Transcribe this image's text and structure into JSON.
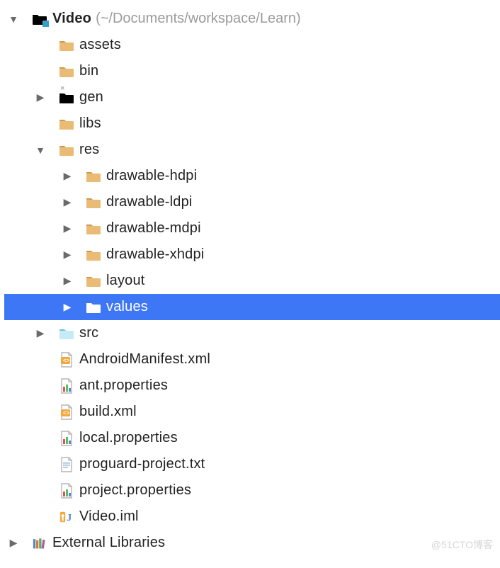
{
  "watermark": "@51CTO博客",
  "tree": [
    {
      "indent": 0,
      "arrow": "down",
      "icon": "folder-tan-badge",
      "bold": true,
      "label": "Video",
      "path": "(~/Documents/workspace/Learn)",
      "interact": true
    },
    {
      "indent": 1,
      "arrow": "",
      "icon": "folder-tan",
      "label": "assets",
      "interact": true
    },
    {
      "indent": 1,
      "arrow": "",
      "icon": "folder-tan",
      "label": "bin",
      "interact": true
    },
    {
      "indent": 1,
      "arrow": "right",
      "icon": "folder-cyan-x",
      "label": "gen",
      "interact": true
    },
    {
      "indent": 1,
      "arrow": "",
      "icon": "folder-tan",
      "label": "libs",
      "interact": true
    },
    {
      "indent": 1,
      "arrow": "down",
      "icon": "folder-tan",
      "label": "res",
      "interact": true
    },
    {
      "indent": 2,
      "arrow": "right",
      "icon": "folder-tan",
      "label": "drawable-hdpi",
      "interact": true
    },
    {
      "indent": 2,
      "arrow": "right",
      "icon": "folder-tan",
      "label": "drawable-ldpi",
      "interact": true
    },
    {
      "indent": 2,
      "arrow": "right",
      "icon": "folder-tan",
      "label": "drawable-mdpi",
      "interact": true
    },
    {
      "indent": 2,
      "arrow": "right",
      "icon": "folder-tan",
      "label": "drawable-xhdpi",
      "interact": true
    },
    {
      "indent": 2,
      "arrow": "right",
      "icon": "folder-tan",
      "label": "layout",
      "interact": true
    },
    {
      "indent": 2,
      "arrow": "right",
      "icon": "folder-white",
      "label": "values",
      "selected": true,
      "interact": true
    },
    {
      "indent": 1,
      "arrow": "right",
      "icon": "folder-cyan",
      "label": "src",
      "interact": true
    },
    {
      "indent": 1,
      "arrow": "",
      "icon": "file-xml",
      "label": "AndroidManifest.xml",
      "interact": true
    },
    {
      "indent": 1,
      "arrow": "",
      "icon": "file-props",
      "label": "ant.properties",
      "interact": true
    },
    {
      "indent": 1,
      "arrow": "",
      "icon": "file-xml",
      "label": "build.xml",
      "interact": true
    },
    {
      "indent": 1,
      "arrow": "",
      "icon": "file-props",
      "label": "local.properties",
      "interact": true
    },
    {
      "indent": 1,
      "arrow": "",
      "icon": "file-txt",
      "label": "proguard-project.txt",
      "interact": true
    },
    {
      "indent": 1,
      "arrow": "",
      "icon": "file-props",
      "label": "project.properties",
      "interact": true
    },
    {
      "indent": 1,
      "arrow": "",
      "icon": "file-iml",
      "label": "Video.iml",
      "interact": true
    },
    {
      "indent": 0,
      "arrow": "right",
      "icon": "libraries",
      "label": "External Libraries",
      "interact": true
    }
  ]
}
